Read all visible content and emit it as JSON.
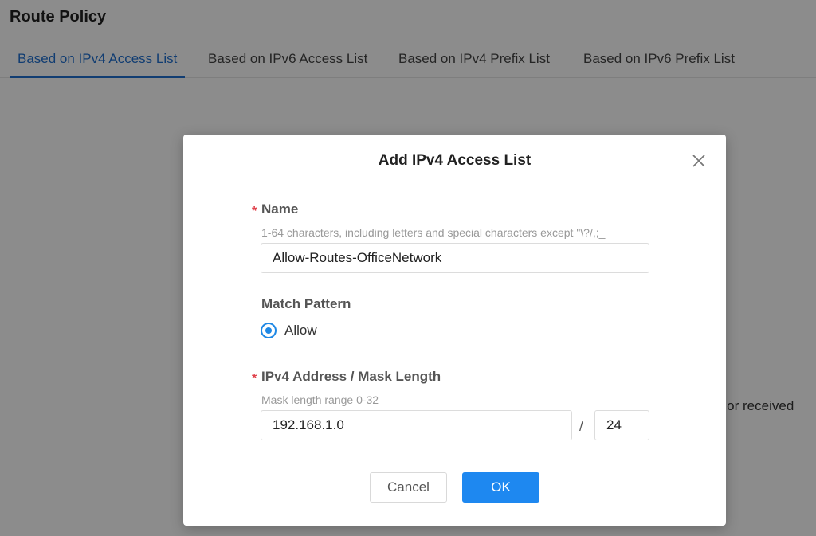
{
  "page": {
    "title": "Route Policy",
    "tabs": [
      {
        "label": "Based on IPv4 Access List",
        "active": true
      },
      {
        "label": "Based on IPv6 Access List",
        "active": false
      },
      {
        "label": "Based on IPv4 Prefix List",
        "active": false
      },
      {
        "label": "Based on IPv6 Prefix List",
        "active": false
      }
    ],
    "background_text": "d or received"
  },
  "modal": {
    "title": "Add IPv4 Access List",
    "name": {
      "required_mark": "*",
      "label": "Name",
      "hint": "1-64 characters, including letters and special characters except \"\\?/,;_",
      "value": "Allow-Routes-OfficeNetwork"
    },
    "match_pattern": {
      "label": "Match Pattern",
      "option_label": "Allow",
      "selected": true
    },
    "address": {
      "required_mark": "*",
      "label": "IPv4 Address / Mask Length",
      "hint": "Mask length range 0-32",
      "ip_value": "192.168.1.0",
      "separator": "/",
      "mask_value": "24"
    },
    "buttons": {
      "cancel": "Cancel",
      "ok": "OK"
    }
  },
  "colors": {
    "accent": "#1e88f0",
    "active_tab": "#1f6fcf",
    "required": "#e0414b"
  },
  "icons": {
    "close": "close-icon"
  }
}
